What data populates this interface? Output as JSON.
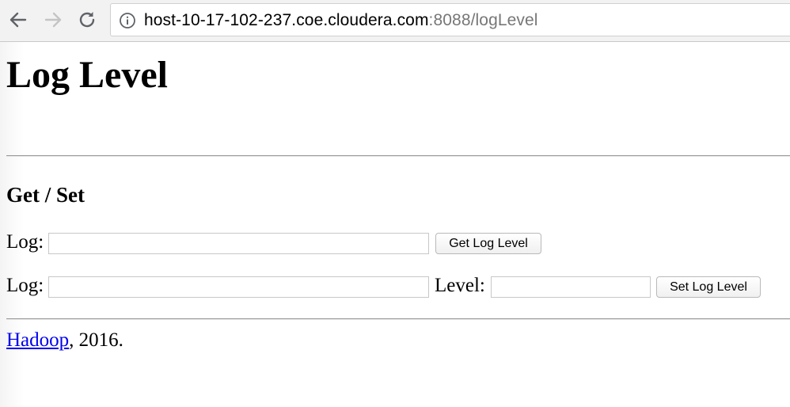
{
  "browser": {
    "url_host": "host-10-17-102-237.coe.cloudera.com",
    "url_rest": ":8088/logLevel",
    "icons": {
      "back": "back-arrow-icon",
      "forward": "forward-arrow-icon",
      "reload": "reload-icon",
      "info": "info-icon"
    }
  },
  "page": {
    "title": "Log Level",
    "section_title": "Get / Set",
    "get_form": {
      "log_label": "Log:",
      "log_value": "",
      "button_label": "Get Log Level"
    },
    "set_form": {
      "log_label": "Log:",
      "log_value": "",
      "level_label": "Level:",
      "level_value": "",
      "button_label": "Set Log Level"
    },
    "footer": {
      "link_text": "Hadoop",
      "suffix": ", 2016."
    }
  },
  "colors": {
    "link": "#0000ee",
    "toolbar_bg": "#f2f2f2",
    "url_rest": "#777777"
  }
}
